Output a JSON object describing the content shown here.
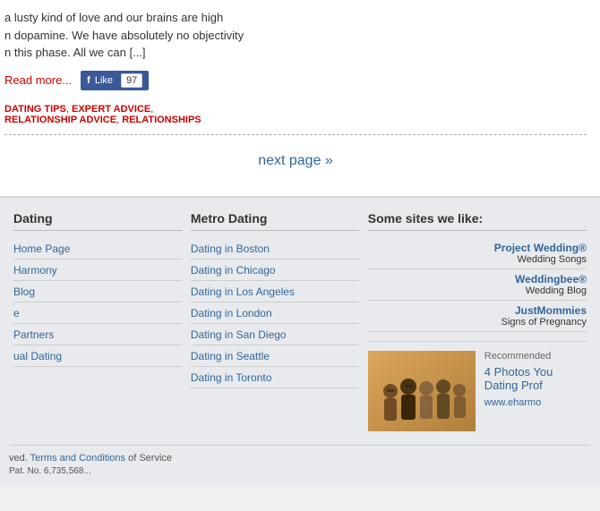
{
  "article": {
    "text_line1": "a lusty kind of love and our brains are high",
    "text_line2": "n dopamine. We have absolutely no objectivity",
    "text_line3": "n this phase. All we can [...]",
    "read_more": "Read more...",
    "fb_like": "Like",
    "fb_count": "97",
    "tags": "DATING TIPS, EXPERT ADVICE,",
    "tags2": "RELATIONSHIP ADVICE, RELATIONSHIPS",
    "next_page": "next page »"
  },
  "sidebar_dating": {
    "heading": "Dating",
    "items": [
      {
        "label": "Home Page",
        "url": "#"
      },
      {
        "label": "Harmony",
        "url": "#"
      },
      {
        "label": "Blog",
        "url": "#"
      },
      {
        "label": "e",
        "url": "#"
      },
      {
        "label": "Partners",
        "url": "#"
      },
      {
        "label": "ual Dating",
        "url": "#"
      }
    ]
  },
  "sidebar_metro": {
    "heading": "Metro Dating",
    "items": [
      {
        "label": "Dating in Boston",
        "url": "#"
      },
      {
        "label": "Dating in Chicago",
        "url": "#"
      },
      {
        "label": "Dating in Los Angeles",
        "url": "#"
      },
      {
        "label": "Dating in London",
        "url": "#"
      },
      {
        "label": "Dating in San Diego",
        "url": "#"
      },
      {
        "label": "Dating in Seattle",
        "url": "#"
      },
      {
        "label": "Dating in Toronto",
        "url": "#"
      }
    ]
  },
  "sites_we_like": {
    "heading": "Some sites we like:",
    "items": [
      {
        "name": "Project Wedding®",
        "sub": "Wedding Songs"
      },
      {
        "name": "Weddingbee®",
        "sub": "Wedding Blog"
      },
      {
        "name": "JustMommies",
        "sub": "Signs of Pregnancy"
      }
    ]
  },
  "promo": {
    "recommended": "Recommended",
    "title": "4 Photos You Dating Prof",
    "url": "www.eharmo"
  },
  "footer": {
    "rights_text": "ved.",
    "terms_link": "Terms and Conditions",
    "of_service": "of Service",
    "patent": "Pat. No. 6,735,568..."
  }
}
